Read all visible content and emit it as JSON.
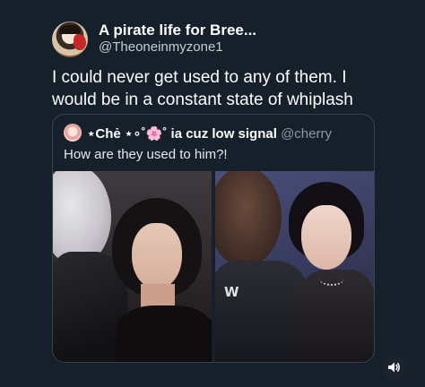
{
  "tweet": {
    "display_name": "A pirate life for Bree...",
    "handle": "@Theoneinmyzone1",
    "text": "I could never get used to any of them. I would be in a constant state of whiplash"
  },
  "quote": {
    "name_prefix": "⋆Chė ⋆∘˚",
    "name_flower": "🌸",
    "name_suffix": "˚ ia cuz low signal",
    "handle": "@cherry",
    "text": "How are they used to him?!"
  },
  "media": {
    "right_photo_shirt_mark": "W",
    "sound_icon": "volume-icon"
  }
}
